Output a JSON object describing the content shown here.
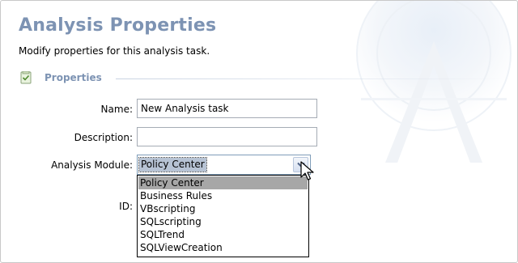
{
  "page": {
    "title": "Analysis Properties",
    "subtitle": "Modify properties for this analysis task."
  },
  "section": {
    "label": "Properties",
    "icon": "properties-page-icon"
  },
  "form": {
    "name_label": "Name:",
    "name_value": "New Analysis task",
    "description_label": "Description:",
    "description_value": "",
    "module_label": "Analysis Module:",
    "module_value": "Policy Center",
    "id_label": "ID:"
  },
  "dropdown": {
    "options": [
      {
        "label": "Policy Center",
        "selected": true
      },
      {
        "label": "Business Rules",
        "selected": false
      },
      {
        "label": "VBscripting",
        "selected": false
      },
      {
        "label": "SQLscripting",
        "selected": false
      },
      {
        "label": "SQLTrend",
        "selected": false
      },
      {
        "label": "SQLViewCreation",
        "selected": false
      }
    ]
  },
  "colors": {
    "title": "#7d93b3",
    "selection": "#b7c3d4",
    "list_highlight": "#a7a7a7"
  }
}
